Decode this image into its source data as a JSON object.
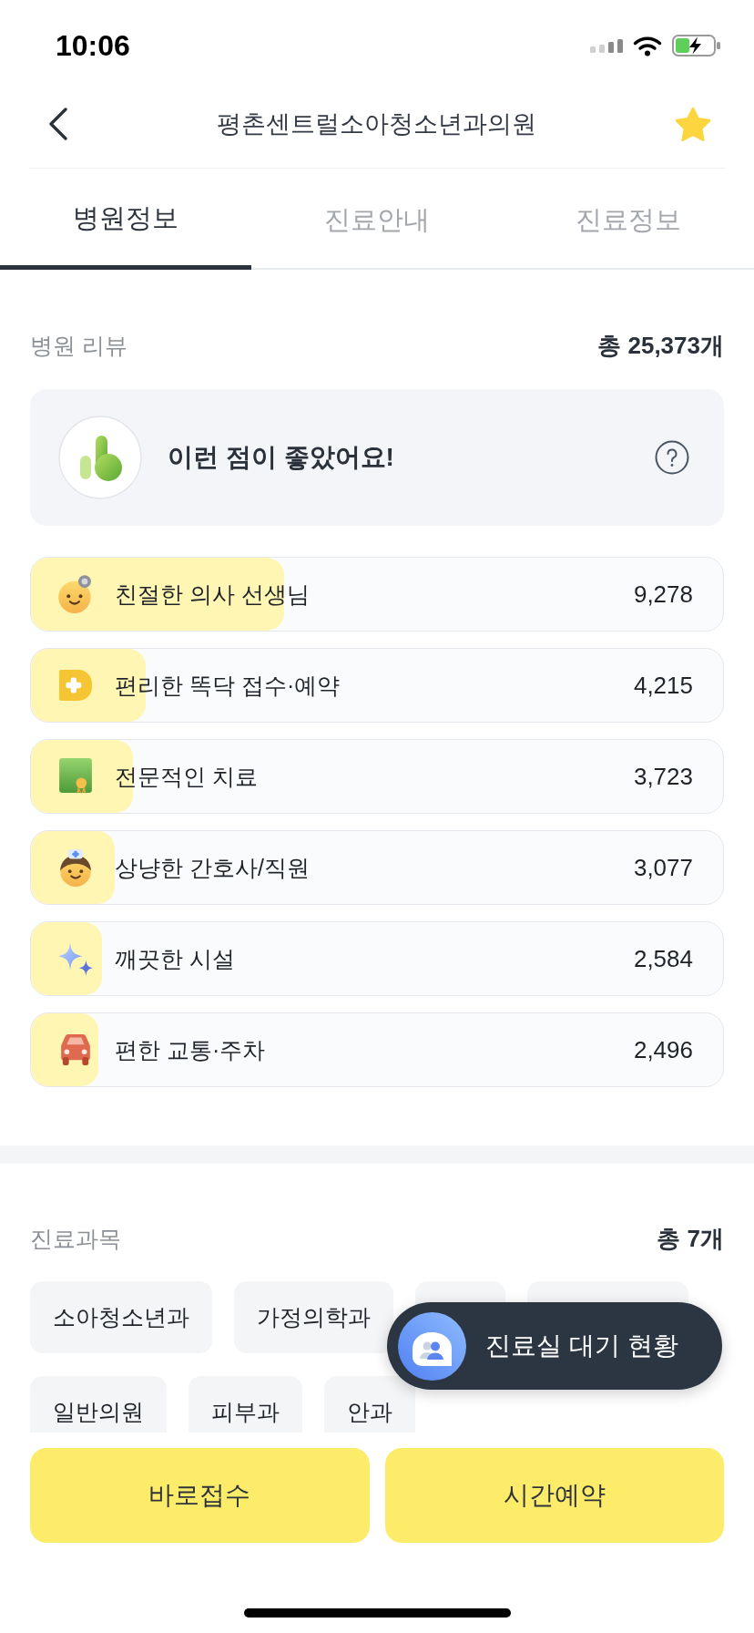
{
  "status_bar": {
    "time": "10:06"
  },
  "header": {
    "title": "평촌센트럴소아청소년과의원",
    "favorited": true
  },
  "tabs": [
    {
      "label": "병원정보",
      "selected": true
    },
    {
      "label": "진료안내",
      "selected": false
    },
    {
      "label": "진료정보",
      "selected": false
    }
  ],
  "reviews": {
    "title": "병원 리뷰",
    "total": "총 25,373개",
    "highlight": "이런 점이 좋았어요!",
    "items": [
      {
        "label": "친절한 의사 선생님",
        "count": "9,278",
        "level": 0.366
      },
      {
        "label": "편리한 똑닥 접수·예약",
        "count": "4,215",
        "level": 0.166
      },
      {
        "label": "전문적인 치료",
        "count": "3,723",
        "level": 0.147
      },
      {
        "label": "상냥한 간호사/직원",
        "count": "3,077",
        "level": 0.121
      },
      {
        "label": "깨끗한 시설",
        "count": "2,584",
        "level": 0.102
      },
      {
        "label": "편한 교통·주차",
        "count": "2,496",
        "level": 0.098
      }
    ]
  },
  "departments": {
    "title": "진료과목",
    "total": "총 7개",
    "items": [
      {
        "kind": "text",
        "label": "소아청소년과"
      },
      {
        "kind": "text",
        "label": "가정의학과"
      },
      {
        "kind": "covered"
      },
      {
        "kind": "covered"
      },
      {
        "kind": "text",
        "label": "일반의원"
      },
      {
        "kind": "text",
        "label": "피부과"
      },
      {
        "kind": "text",
        "label": "안과"
      }
    ]
  },
  "floating_button": {
    "label": "진료실 대기 현황"
  },
  "actions": [
    "바로접수",
    "시간예약"
  ]
}
